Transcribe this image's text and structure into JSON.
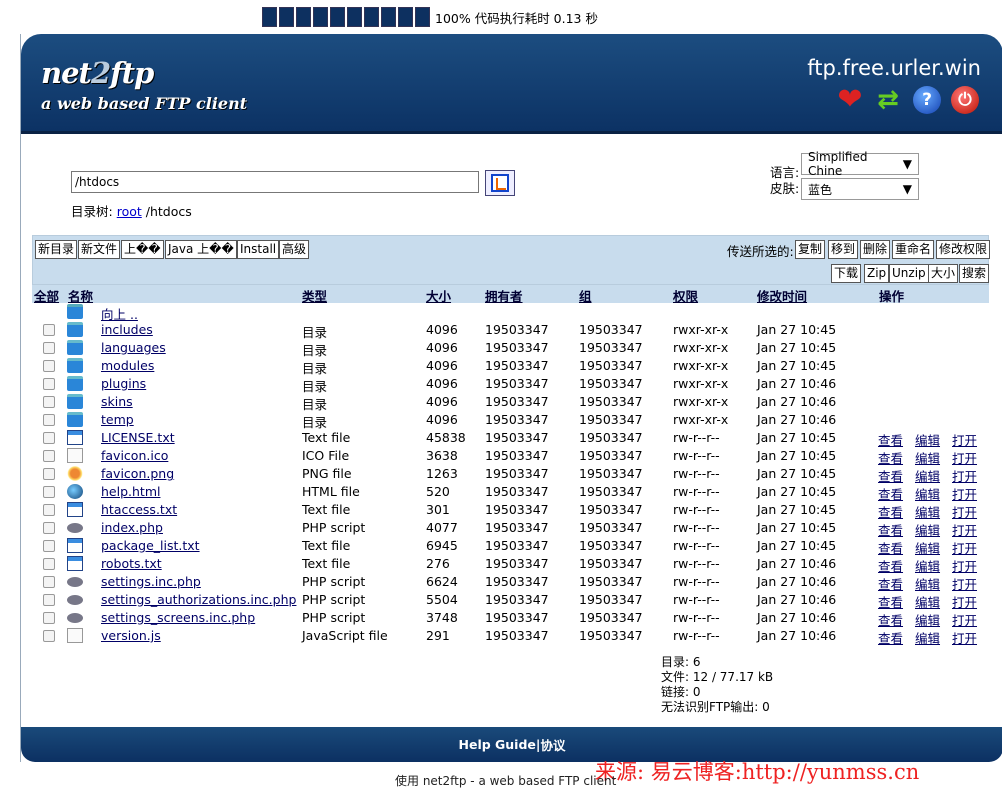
{
  "progress": {
    "text": "100% 代码执行耗时 0.13 秒",
    "value": 1.0
  },
  "header": {
    "logo_a": "net",
    "logo_b": "2",
    "logo_c": "ftp",
    "tagline": "a web based FTP client",
    "server": "ftp.free.urler.win",
    "icons": [
      "heart-icon",
      "refresh-icon",
      "help-icon",
      "power-icon"
    ]
  },
  "path": {
    "value": "/htdocs"
  },
  "breadcrumb": {
    "label": "目录树:",
    "root": "root",
    "path": "/htdocs"
  },
  "settings": {
    "lang_label": "语言:",
    "lang_value": "Simplified Chine",
    "skin_label": "皮肤:",
    "skin_value": "蓝色"
  },
  "toolbar": {
    "left": [
      "新目录",
      "新文件",
      "上��",
      "Java 上��",
      "Install",
      "高级"
    ],
    "selected_label": "传送所选的:",
    "right1": [
      "复制",
      "移到",
      "删除",
      "重命名",
      "修改权限"
    ],
    "right2": [
      "下载",
      "Zip",
      "Unzip",
      "大小",
      "搜索"
    ]
  },
  "columns": {
    "all": "全部",
    "name": "名称",
    "type": "类型",
    "size": "大小",
    "owner": "拥有者",
    "group": "组",
    "perms": "权限",
    "mtime": "修改时间",
    "actions": "操作"
  },
  "up_label": "向上 ..",
  "actions": {
    "view": "查看",
    "edit": "编辑",
    "open": "打开"
  },
  "files": [
    {
      "name": "includes",
      "type": "目录",
      "size": "4096",
      "owner": "19503347",
      "group": "19503347",
      "perms": "rwxr-xr-x",
      "mtime": "Jan 27 10:45",
      "icon": "folder-icon"
    },
    {
      "name": "languages",
      "type": "目录",
      "size": "4096",
      "owner": "19503347",
      "group": "19503347",
      "perms": "rwxr-xr-x",
      "mtime": "Jan 27 10:45",
      "icon": "folder-icon"
    },
    {
      "name": "modules",
      "type": "目录",
      "size": "4096",
      "owner": "19503347",
      "group": "19503347",
      "perms": "rwxr-xr-x",
      "mtime": "Jan 27 10:45",
      "icon": "folder-icon"
    },
    {
      "name": "plugins",
      "type": "目录",
      "size": "4096",
      "owner": "19503347",
      "group": "19503347",
      "perms": "rwxr-xr-x",
      "mtime": "Jan 27 10:46",
      "icon": "folder-icon"
    },
    {
      "name": "skins",
      "type": "目录",
      "size": "4096",
      "owner": "19503347",
      "group": "19503347",
      "perms": "rwxr-xr-x",
      "mtime": "Jan 27 10:46",
      "icon": "folder-icon"
    },
    {
      "name": "temp",
      "type": "目录",
      "size": "4096",
      "owner": "19503347",
      "group": "19503347",
      "perms": "rwxr-xr-x",
      "mtime": "Jan 27 10:46",
      "icon": "folder-icon"
    },
    {
      "name": "LICENSE.txt",
      "type": "Text file",
      "size": "45838",
      "owner": "19503347",
      "group": "19503347",
      "perms": "rw-r--r--",
      "mtime": "Jan 27 10:45",
      "icon": "text-file-icon"
    },
    {
      "name": "favicon.ico",
      "type": "ICO File",
      "size": "3638",
      "owner": "19503347",
      "group": "19503347",
      "perms": "rw-r--r--",
      "mtime": "Jan 27 10:45",
      "icon": "blank-file-icon"
    },
    {
      "name": "favicon.png",
      "type": "PNG file",
      "size": "1263",
      "owner": "19503347",
      "group": "19503347",
      "perms": "rw-r--r--",
      "mtime": "Jan 27 10:45",
      "icon": "image-file-icon"
    },
    {
      "name": "help.html",
      "type": "HTML file",
      "size": "520",
      "owner": "19503347",
      "group": "19503347",
      "perms": "rw-r--r--",
      "mtime": "Jan 27 10:45",
      "icon": "html-file-icon"
    },
    {
      "name": "htaccess.txt",
      "type": "Text file",
      "size": "301",
      "owner": "19503347",
      "group": "19503347",
      "perms": "rw-r--r--",
      "mtime": "Jan 27 10:45",
      "icon": "text-file-icon"
    },
    {
      "name": "index.php",
      "type": "PHP script",
      "size": "4077",
      "owner": "19503347",
      "group": "19503347",
      "perms": "rw-r--r--",
      "mtime": "Jan 27 10:45",
      "icon": "php-file-icon"
    },
    {
      "name": "package_list.txt",
      "type": "Text file",
      "size": "6945",
      "owner": "19503347",
      "group": "19503347",
      "perms": "rw-r--r--",
      "mtime": "Jan 27 10:45",
      "icon": "text-file-icon"
    },
    {
      "name": "robots.txt",
      "type": "Text file",
      "size": "276",
      "owner": "19503347",
      "group": "19503347",
      "perms": "rw-r--r--",
      "mtime": "Jan 27 10:46",
      "icon": "text-file-icon"
    },
    {
      "name": "settings.inc.php",
      "type": "PHP script",
      "size": "6624",
      "owner": "19503347",
      "group": "19503347",
      "perms": "rw-r--r--",
      "mtime": "Jan 27 10:46",
      "icon": "php-file-icon"
    },
    {
      "name": "settings_authorizations.inc.php",
      "type": "PHP script",
      "size": "5504",
      "owner": "19503347",
      "group": "19503347",
      "perms": "rw-r--r--",
      "mtime": "Jan 27 10:46",
      "icon": "php-file-icon"
    },
    {
      "name": "settings_screens.inc.php",
      "type": "PHP script",
      "size": "3748",
      "owner": "19503347",
      "group": "19503347",
      "perms": "rw-r--r--",
      "mtime": "Jan 27 10:46",
      "icon": "php-file-icon"
    },
    {
      "name": "version.js",
      "type": "JavaScript file",
      "size": "291",
      "owner": "19503347",
      "group": "19503347",
      "perms": "rw-r--r--",
      "mtime": "Jan 27 10:46",
      "icon": "blank-file-icon"
    }
  ],
  "stats": {
    "dirs": "目录: 6",
    "files": "文件: 12 / 77.17 kB",
    "links": "链接: 0",
    "unknown": "无法识别FTP输出: 0"
  },
  "footer": {
    "help": "Help Guide",
    "sep": " | ",
    "license": "协议"
  },
  "watermark": "来源: 易云博客:http://yunmss.cn",
  "bottom_text": "使用 net2ftp - a web based FTP client"
}
